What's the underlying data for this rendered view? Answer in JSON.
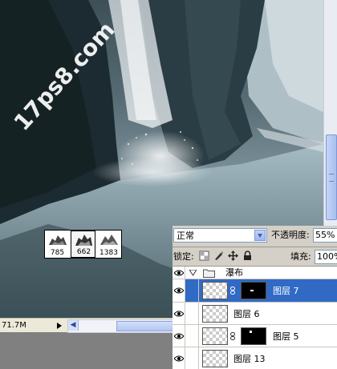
{
  "canvas": {
    "watermark": "17ps8.com",
    "status_size": "71.7M"
  },
  "brush_picker": {
    "presets": [
      {
        "number": "785",
        "icon": "brush-tip-icon"
      },
      {
        "number": "662",
        "icon": "brush-tip-icon",
        "selected": true
      },
      {
        "number": "1383",
        "icon": "brush-tip-icon"
      }
    ]
  },
  "layers_panel": {
    "blend_mode": "正常",
    "opacity_label": "不透明度:",
    "opacity_value": "55%",
    "lock_label": "锁定:",
    "fill_label": "填充:",
    "fill_value": "100%",
    "group": {
      "name": "瀑布"
    },
    "layers": [
      {
        "name": "图层 7",
        "has_mask": true,
        "selected": true
      },
      {
        "name": "图层 6",
        "has_mask": false
      },
      {
        "name": "图层 5",
        "has_mask": true
      },
      {
        "name": "图层 13",
        "has_mask": false
      }
    ]
  },
  "colors": {
    "selection": "#316ac5",
    "panel": "#d4d0c8",
    "canvas_gray": "#808080"
  }
}
